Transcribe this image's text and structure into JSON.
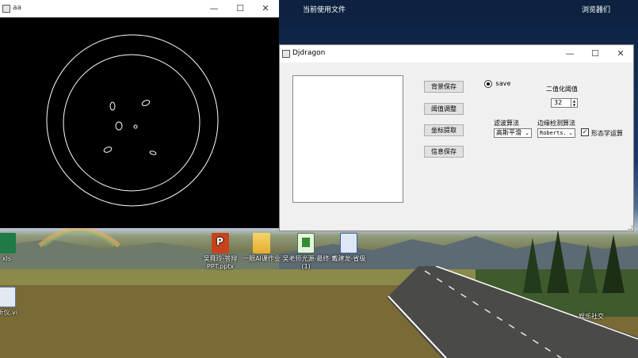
{
  "desktop": {
    "topbar": {
      "recent_files": "当前使用文件",
      "browsers": "浏览器们"
    },
    "icons": [
      {
        "label": "吴舜玲-答辩PPT.pptx",
        "kind": "ppt-icon"
      },
      {
        "label": "一眼AI课作业",
        "kind": "folder-icon"
      },
      {
        "label": "吴老师光源-最终 (1)",
        "kind": "document-icon"
      },
      {
        "label": "戴建龙-省级",
        "kind": "document-icon"
      },
      {
        "label": "xls",
        "kind": "excel-icon"
      },
      {
        "label": "析仪.vi",
        "kind": "file-icon"
      },
      {
        "label": "娱乐社交",
        "kind": "folder-label"
      }
    ]
  },
  "window_aa": {
    "title": "aa",
    "controls": {
      "minimize": "—",
      "maximize": "☐",
      "close": "✕"
    }
  },
  "window_djdragon": {
    "title": "Djdragon",
    "controls": {
      "minimize": "—",
      "maximize": "☐",
      "close": "✕"
    },
    "buttons": {
      "bg_save": "背景保存",
      "threshold_adjust": "阈值调整",
      "coord_extract": "坐标提取",
      "info_save": "信息保存"
    },
    "radio": {
      "label": "save",
      "checked": true
    },
    "binarize": {
      "label": "二值化阈值",
      "value": "32"
    },
    "filter": {
      "label": "滤波算法",
      "selected": "高斯平滑"
    },
    "edge": {
      "label": "边缘检测算法",
      "selected": "Roberts."
    },
    "morph": {
      "label": "形态学运算",
      "checked": true
    }
  },
  "colors": {
    "window_bg": "#f0f0f0",
    "canvas_bg": "#000000",
    "edge_stroke": "#ffffff"
  }
}
